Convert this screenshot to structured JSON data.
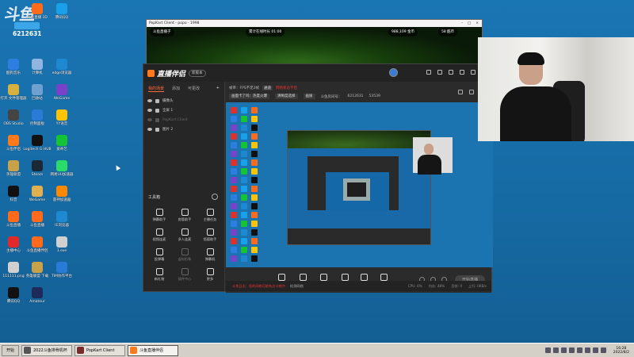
{
  "watermark": {
    "brand": "斗鱼",
    "room": "6212631"
  },
  "desktop_icons": [
    {
      "label": "网易云音乐",
      "color": "#e0302a"
    },
    {
      "label": "斗鱼直播 3D",
      "color": "#ff6b1a"
    },
    {
      "label": "腾讯QQ",
      "color": "#1aa0e8"
    },
    {
      "label": "酷狗音乐",
      "color": "#2e7de0"
    },
    {
      "label": "计算机",
      "color": "#8fb5e0"
    },
    {
      "label": "edge浏览器",
      "color": "#1e88d0"
    },
    {
      "label": "打开 文件管理器",
      "color": "#d7b040"
    },
    {
      "label": "回收站",
      "color": "#6fa0d0"
    },
    {
      "label": "WeGame",
      "color": "#7a42c8"
    },
    {
      "label": "OBS Studio",
      "color": "#444444"
    },
    {
      "label": "控制面板",
      "color": "#2a7ad8"
    },
    {
      "label": "YY语音",
      "color": "#ffc400"
    },
    {
      "label": "斗鱼伴侣",
      "color": "#ff7a1a"
    },
    {
      "label": "Logitech G HUB",
      "color": "#111111"
    },
    {
      "label": "爱奇艺",
      "color": "#15c435"
    },
    {
      "label": "英雄联盟",
      "color": "#c8a24a"
    },
    {
      "label": "Steam",
      "color": "#1b2838"
    },
    {
      "label": "网易UU加速器",
      "color": "#2adb6a"
    },
    {
      "label": "抖音",
      "color": "#111111"
    },
    {
      "label": "WeGame",
      "color": "#e0b050"
    },
    {
      "label": "雷神加速器",
      "color": "#ff8800"
    },
    {
      "label": "斗鱼直播",
      "color": "#ff6b1a"
    },
    {
      "label": "斗鱼直播",
      "color": "#ff6b1a"
    },
    {
      "label": "IE浏览器",
      "color": "#1e88d0"
    },
    {
      "label": "主播中心",
      "color": "#e02a2a"
    },
    {
      "label": "斗鱼直播伴侣",
      "color": "#ff6b1a"
    },
    {
      "label": "1.exe",
      "color": "#d0d0d0"
    },
    {
      "label": "111111.png",
      "color": "#d0d0d0"
    },
    {
      "label": "英雄联盟 下载",
      "color": "#c8a24a"
    },
    {
      "label": "TIM协作平台",
      "color": "#2a7ad8"
    },
    {
      "label": "腾讯QQ",
      "color": "#111111"
    },
    {
      "label": "Amateur",
      "color": "#1e2a5a"
    }
  ],
  "game_window": {
    "title": "PopKart Client - popo - 1998",
    "hud_center": "累计在线时长  01:00",
    "hud_player": "斗鱼直播子",
    "hud_money": "988,109 金币",
    "hud_points": "58 酷币"
  },
  "app": {
    "brand": "直播伴侣",
    "version": "新版本",
    "tabs": [
      "我的场景",
      "添加",
      "可更改"
    ],
    "scenes": [
      {
        "name": "摄像头",
        "dim": false
      },
      {
        "name": "全屏 1",
        "dim": false
      },
      {
        "name": "PopKart Client",
        "dim": true
      },
      {
        "name": "图片 2",
        "dim": false
      }
    ],
    "tools_title": "工具箱",
    "tools": [
      {
        "label": "弹幕助手",
        "dim": false
      },
      {
        "label": "房管助手",
        "dim": false
      },
      {
        "label": "主播任务",
        "dim": false
      },
      {
        "label": "视频连麦",
        "dim": false
      },
      {
        "label": "多人连麦",
        "dim": false
      },
      {
        "label": "悟德助手",
        "dim": false
      },
      {
        "label": "投弹幕",
        "dim": false
      },
      {
        "label": "虚拟形象",
        "dim": true
      },
      {
        "label": "弹幕机",
        "dim": false
      },
      {
        "label": "新礼物",
        "dim": false
      },
      {
        "label": "插件中心",
        "dim": true
      },
      {
        "label": "更多",
        "dim": false
      }
    ],
    "info_row1": {
      "label": "帧率：FPS不足2帧",
      "tag": "通道",
      "warn": "网络状态不佳"
    },
    "info_row2": {
      "chip1": "画面卡了吗：热度火爆",
      "chip2": "清晰度选择",
      "chip3": "画质",
      "viewers_label": "斗鱼房间号：",
      "viewers": "6212631",
      "hot": "53539"
    },
    "bottom_bar": [
      "直播录屏",
      "摄像头",
      "手机投屏",
      "多媒体",
      "麦克风",
      "扬声器"
    ],
    "live_button": "开始直播",
    "status_msg": "斗鱼日志：您的网络可能有点卡顿中",
    "status_link": "检测网络",
    "stats": [
      "CPU: 6%",
      "内存: 48%",
      "丢帧: 0",
      "上行: 0KB/s"
    ]
  },
  "taskbar": {
    "start": "开始",
    "buttons": [
      {
        "label": "2022斗鱼排骨机杯",
        "active": false
      },
      {
        "label": "PopKart Client",
        "active": false
      },
      {
        "label": "斗鱼直播伴侣",
        "active": true
      }
    ],
    "time": "16:28",
    "date": "2022/8/2"
  }
}
